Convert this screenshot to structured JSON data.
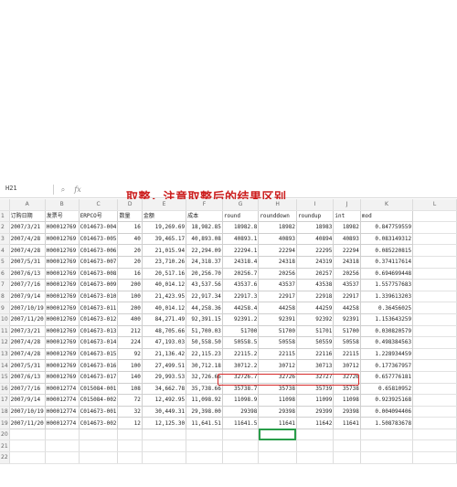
{
  "formula_bar": {
    "cell_ref": "H21",
    "fx": "fx"
  },
  "annotation": "取整，注意取整后的结果区别",
  "columns": [
    "A",
    "B",
    "C",
    "D",
    "E",
    "F",
    "G",
    "H",
    "I",
    "J",
    "K",
    "L"
  ],
  "headers": [
    "订购日期",
    "发票号",
    "ERPCO号",
    "数量",
    "金额",
    "成本",
    "round",
    "rounddown",
    "roundup",
    "int",
    "mod"
  ],
  "rows": [
    [
      "2007/3/21",
      "H00012769",
      "C014673-004",
      "16",
      "19,269.69",
      "18,982.85",
      "18982.8",
      "18982",
      "18983",
      "18982",
      "0.847759559"
    ],
    [
      "2007/4/28",
      "H00012769",
      "C014673-005",
      "40",
      "39,465.17",
      "40,893.08",
      "40893.1",
      "40893",
      "40894",
      "40893",
      "0.083149312"
    ],
    [
      "2007/4/28",
      "H00012769",
      "C014673-006",
      "20",
      "21,015.94",
      "22,294.09",
      "22294.1",
      "22294",
      "22295",
      "22294",
      "0.085220815"
    ],
    [
      "2007/5/31",
      "H00012769",
      "C014673-007",
      "20",
      "23,710.26",
      "24,318.37",
      "24318.4",
      "24318",
      "24319",
      "24318",
      "0.374117614"
    ],
    [
      "2007/6/13",
      "H00012769",
      "C014673-008",
      "16",
      "20,517.16",
      "20,256.70",
      "20256.7",
      "20256",
      "20257",
      "20256",
      "0.694699448"
    ],
    [
      "2007/7/16",
      "H00012769",
      "C014673-009",
      "200",
      "40,014.12",
      "43,537.56",
      "43537.6",
      "43537",
      "43538",
      "43537",
      "1.557757683"
    ],
    [
      "2007/9/14",
      "H00012769",
      "C014673-010",
      "100",
      "21,423.95",
      "22,917.34",
      "22917.3",
      "22917",
      "22918",
      "22917",
      "1.339613203"
    ],
    [
      "2007/10/19",
      "H00012769",
      "C014673-011",
      "200",
      "40,014.12",
      "44,258.36",
      "44258.4",
      "44258",
      "44259",
      "44258",
      "0.36456025"
    ],
    [
      "2007/11/20",
      "H00012769",
      "C014673-012",
      "400",
      "84,271.49",
      "92,391.15",
      "92391.2",
      "92391",
      "92392",
      "92391",
      "1.153643259"
    ],
    [
      "2007/3/21",
      "H00012769",
      "C014673-013",
      "212",
      "48,705.66",
      "51,700.03",
      "51700",
      "51700",
      "51701",
      "51700",
      "0.030820579"
    ],
    [
      "2007/4/28",
      "H00012769",
      "C014673-014",
      "224",
      "47,193.03",
      "50,558.50",
      "50558.5",
      "50558",
      "50559",
      "50558",
      "0.498384563"
    ],
    [
      "2007/4/28",
      "H00012769",
      "C014673-015",
      "92",
      "21,136.42",
      "22,115.23",
      "22115.2",
      "22115",
      "22116",
      "22115",
      "1.228934459"
    ],
    [
      "2007/5/31",
      "H00012769",
      "C014673-016",
      "100",
      "27,499.51",
      "30,712.18",
      "30712.2",
      "30712",
      "30713",
      "30712",
      "0.177367957"
    ],
    [
      "2007/6/13",
      "H00012769",
      "C014673-017",
      "140",
      "29,993.53",
      "32,726.66",
      "32726.7",
      "32726",
      "32727",
      "32726",
      "0.657776181"
    ],
    [
      "2007/7/16",
      "H00012774",
      "C015084-001",
      "108",
      "34,662.78",
      "35,738.66",
      "35738.7",
      "35738",
      "35739",
      "35738",
      "0.65810952"
    ],
    [
      "2007/9/14",
      "H00012774",
      "C015084-002",
      "72",
      "12,492.95",
      "11,098.92",
      "11098.9",
      "11098",
      "11099",
      "11098",
      "0.923925168"
    ],
    [
      "2007/10/19",
      "H00012774",
      "C014673-001",
      "32",
      "30,449.31",
      "29,398.00",
      "29398",
      "29398",
      "29399",
      "29398",
      "0.004094406"
    ],
    [
      "2007/11/20",
      "H00012774",
      "C014673-002",
      "12",
      "12,125.30",
      "11,641.51",
      "11641.5",
      "11641",
      "11642",
      "11641",
      "1.508783678"
    ]
  ]
}
